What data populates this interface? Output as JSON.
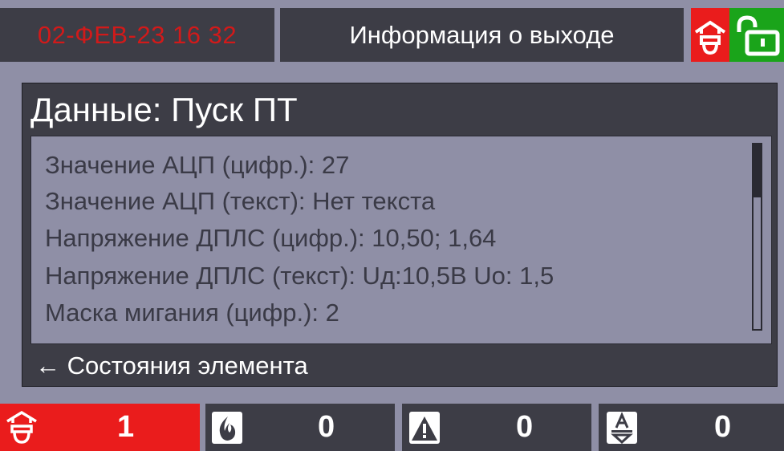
{
  "header": {
    "datetime": "02-ФЕВ-23  16 32",
    "title": "Информация о выходе",
    "icons": [
      "fire-alarm-icon",
      "unlocked-padlock-icon"
    ]
  },
  "panel": {
    "title": "Данные: Пуск ПТ",
    "items": [
      "Значение АЦП (цифр.): 27",
      "Значение АЦП (текст):    Нет текста",
      "Напряжение ДПЛС (цифр.): 10,50; 1,64",
      "Напряжение ДПЛС (текст): Uд:10,5В Uo: 1,5",
      "Маска мигания (цифр.): 2"
    ],
    "back_label": "← Состояния элемента"
  },
  "footer": {
    "counters": [
      {
        "icon": "fire-alarm-icon",
        "value": "1"
      },
      {
        "icon": "fire-extinguishing-icon",
        "value": "0"
      },
      {
        "icon": "warning-triangle-icon",
        "value": "0"
      },
      {
        "icon": "fault-icon",
        "value": "0"
      }
    ]
  },
  "colors": {
    "background": "#8f8fa6",
    "dark_panel": "#3d3d46",
    "alarm_red": "#ea1c1c",
    "ok_green": "#1aa41a",
    "datetime_red": "#d11a1a"
  }
}
